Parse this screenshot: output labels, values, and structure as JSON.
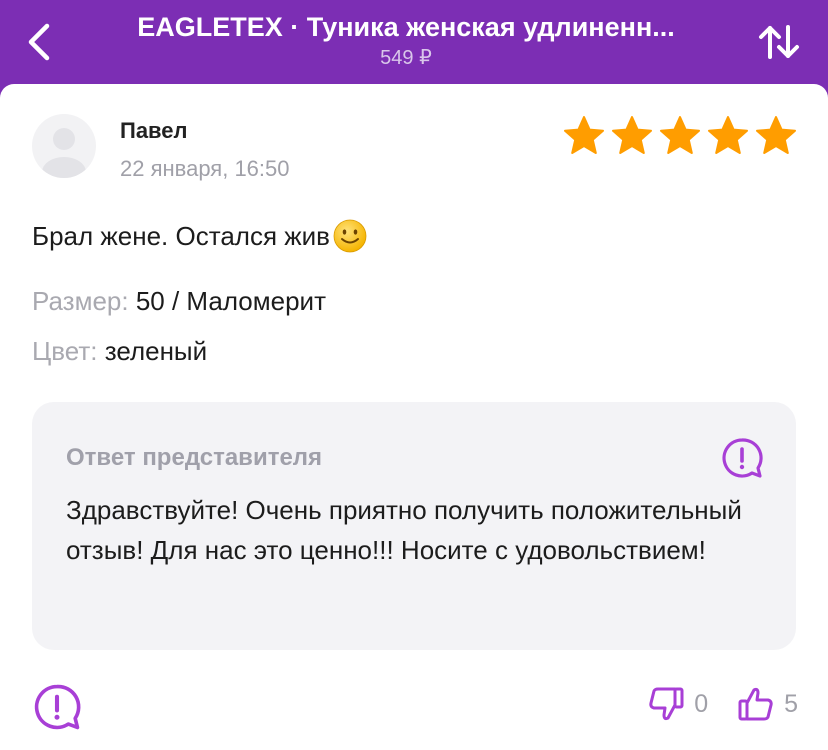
{
  "header": {
    "title": "EAGLETEX · Туника женская удлиненн...",
    "price": "549 ₽"
  },
  "review": {
    "author": "Павел",
    "date": "22 января, 16:50",
    "rating": 5,
    "rating_max": 5,
    "text": "Брал жене. Остался жив",
    "size_label": "Размер:",
    "size_value": "50 / Маломерит",
    "color_label": "Цвет:",
    "color_value": "зеленый"
  },
  "reply": {
    "title": "Ответ представителя",
    "text": "Здравствуйте! Очень приятно получить положительный отзыв! Для нас это ценно!!! Носите с удовольствием!"
  },
  "votes": {
    "dislikes": "0",
    "likes": "5"
  },
  "colors": {
    "brand": "#7c2eb4",
    "star": "#ff9d00",
    "accent_icon": "#a83fd6"
  }
}
